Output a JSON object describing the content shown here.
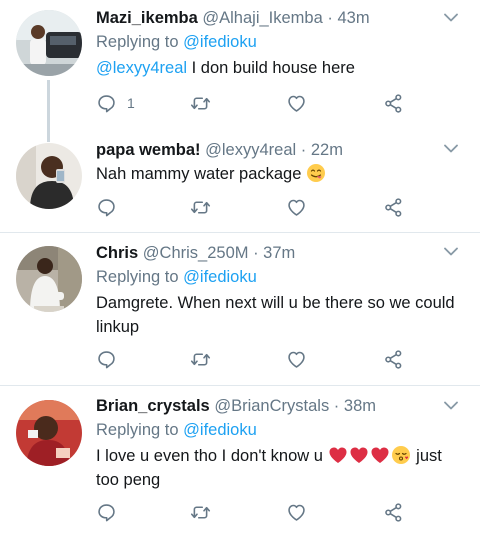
{
  "tweets": [
    {
      "name": "Mazi_ikemba",
      "handle": "@Alhaji_Ikemba",
      "time": "43m",
      "replying_label": "Replying to",
      "replying_to": "@ifedioku",
      "mention": "@lexyy4real",
      "text": " I don build house here",
      "reply_count": "1"
    },
    {
      "name": "papa wemba!",
      "handle": "@lexyy4real",
      "time": "22m",
      "text": "Nah mammy water package",
      "emoji": "face-savoring-food"
    },
    {
      "name": "Chris",
      "handle": "@Chris_250M",
      "time": "37m",
      "replying_label": "Replying to",
      "replying_to": "@ifedioku",
      "text": "Damgrete. When next will u be there so we could linkup"
    },
    {
      "name": "Brian_crystals",
      "handle": "@BrianCrystals",
      "time": "38m",
      "replying_label": "Replying to",
      "replying_to": "@ifedioku",
      "text_before": "I love u even tho I don't know u ",
      "emojis": [
        "red-heart",
        "red-heart",
        "red-heart",
        "face-blowing-kiss"
      ],
      "text_after": " just too peng"
    }
  ],
  "separator": "·",
  "colors": {
    "link": "#1da1f2",
    "muted": "#657786",
    "divider": "#e1e8ed",
    "heart_emoji": "#dd2e44"
  },
  "icons": [
    "reply-icon",
    "retweet-icon",
    "like-icon",
    "share-icon",
    "chevron-down-icon"
  ]
}
